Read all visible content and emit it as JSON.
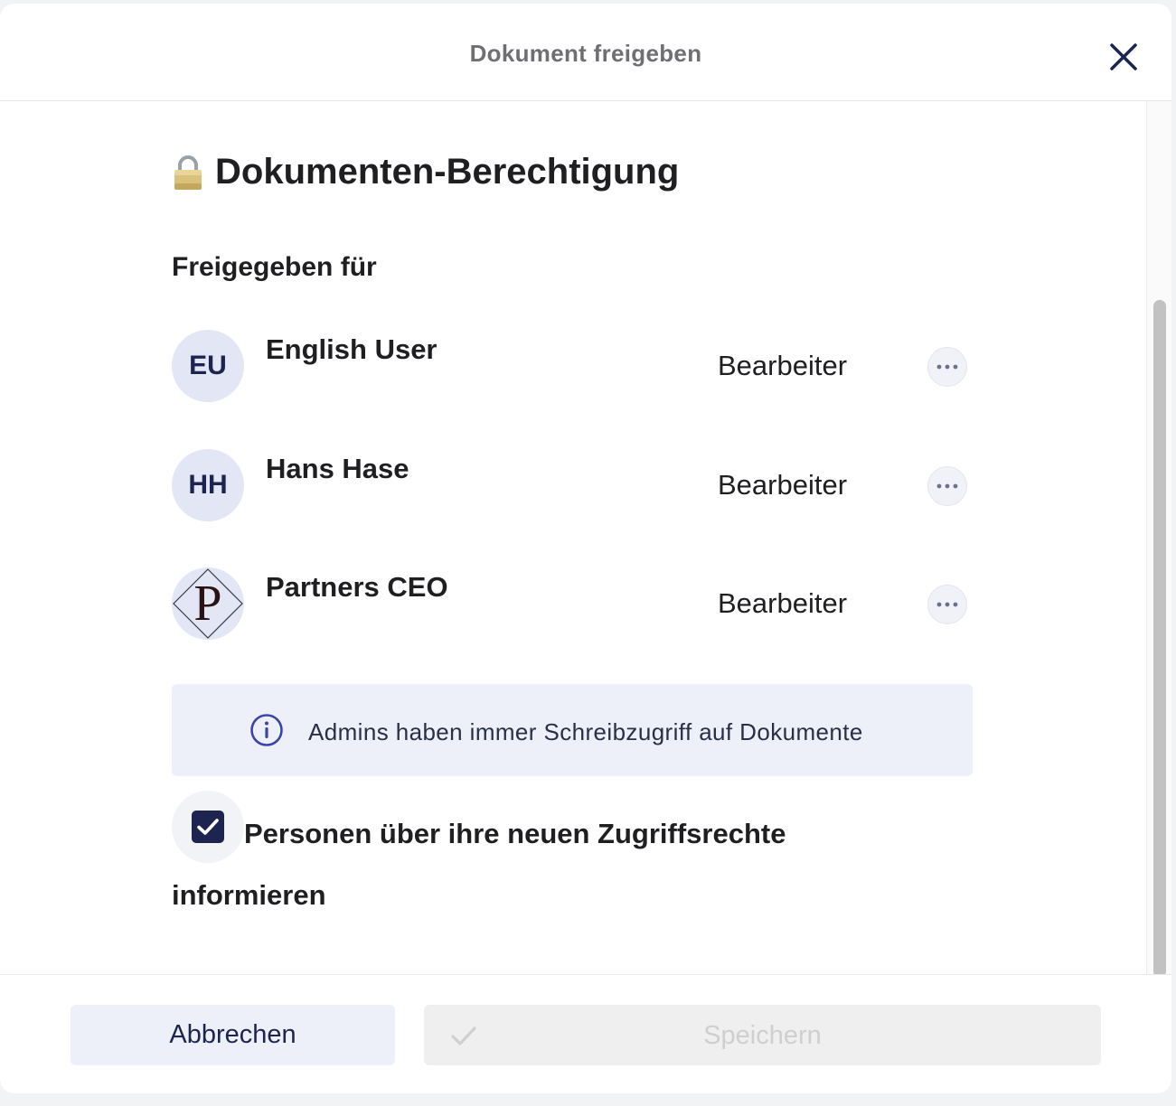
{
  "dialog": {
    "title": "Dokument freigeben",
    "close_icon": "close-icon"
  },
  "section": {
    "icon": "lock-icon",
    "title": "Dokumenten-Berechtigung",
    "shared_with_label": "Freigegeben für"
  },
  "users": [
    {
      "initials": "EU",
      "name": "English User",
      "role": "Bearbeiter",
      "avatar_type": "initials"
    },
    {
      "initials": "HH",
      "name": "Hans Hase",
      "role": "Bearbeiter",
      "avatar_type": "initials"
    },
    {
      "initials": "P",
      "name": "Partners CEO",
      "role": "Bearbeiter",
      "avatar_type": "logo"
    }
  ],
  "info": {
    "icon": "info-icon",
    "text": "Admins haben immer Schreibzugriff auf Dokumente"
  },
  "notify": {
    "checked": true,
    "label": "Personen über ihre neuen Zugriffsrechte informieren"
  },
  "footer": {
    "cancel_label": "Abbrechen",
    "save_label": "Speichern"
  },
  "colors": {
    "primary": "#1d2450",
    "avatar_bg": "#e2e6f5",
    "info_bg": "#edf0f9",
    "disabled_bg": "#efefef",
    "disabled_text": "#cfcfcf"
  }
}
